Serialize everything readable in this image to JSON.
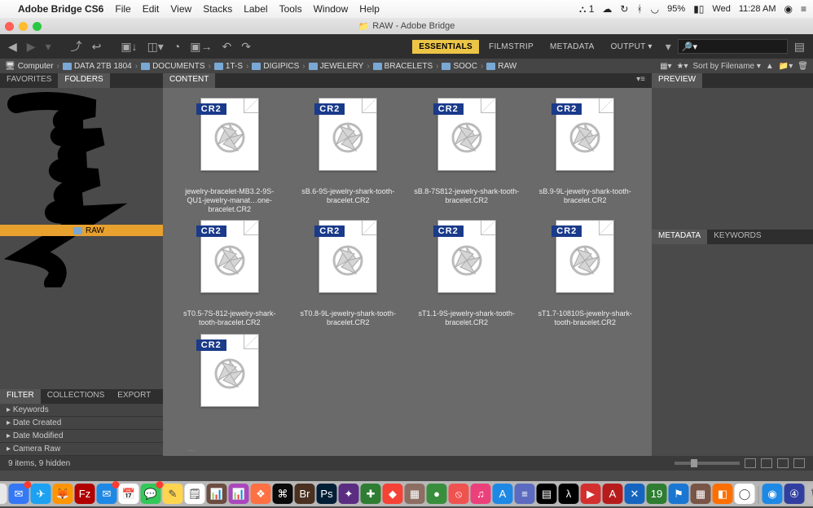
{
  "mac_menu": {
    "app_name": "Adobe Bridge CS6",
    "items": [
      "File",
      "Edit",
      "View",
      "Stacks",
      "Label",
      "Tools",
      "Window",
      "Help"
    ],
    "status_right": {
      "a_badge": "1",
      "battery": "95%",
      "day": "Wed",
      "time": "11:28 AM"
    }
  },
  "window": {
    "title": "RAW - Adobe Bridge"
  },
  "toolbar": {
    "tabs": [
      "ESSENTIALS",
      "FILMSTRIP",
      "METADATA",
      "OUTPUT"
    ],
    "active_tab": "ESSENTIALS",
    "search_placeholder": ""
  },
  "breadcrumb": {
    "items": [
      "Computer",
      "DATA 2TB 1804",
      "DOCUMENTS",
      "1T-S",
      "DIGIPICS",
      "JEWELERY",
      "BRACELETS",
      "SOOC",
      "RAW"
    ],
    "sort_label": "Sort by Filename ▾"
  },
  "left": {
    "tabs": [
      "FAVORITES",
      "FOLDERS"
    ],
    "active_tab": "FOLDERS",
    "selected_folder": "RAW",
    "filter_tabs": [
      "FILTER",
      "COLLECTIONS",
      "EXPORT"
    ],
    "filters": [
      "Keywords",
      "Date Created",
      "Date Modified",
      "Camera Raw"
    ]
  },
  "content": {
    "tab": "CONTENT",
    "files": [
      {
        "name": "jewelry-bracelet-MB3.2-9S-QU1-jewelry-manat…one-bracelet.CR2"
      },
      {
        "name": "sB.6-9S-jewelry-shark-tooth-bracelet.CR2"
      },
      {
        "name": "sB.8-7S812-jewelry-shark-tooth-bracelet.CR2"
      },
      {
        "name": "sB.9-9L-jewelry-shark-tooth-bracelet.CR2"
      },
      {
        "name": "sT0.5-7S-812-jewelry-shark-tooth-bracelet.CR2"
      },
      {
        "name": "sT0.8-9L-jewelry-shark-tooth-bracelet.CR2"
      },
      {
        "name": "sT1.1-9S-jewelry-shark-tooth-bracelet.CR2"
      },
      {
        "name": "sT1.7-10810S-jewelry-shark-tooth-bracelet.CR2"
      },
      {
        "name": ""
      }
    ],
    "truncated_hint": "…",
    "cr2_badge": "CR2"
  },
  "right": {
    "preview_tab": "PREVIEW",
    "meta_tabs": [
      "METADATA",
      "KEYWORDS"
    ]
  },
  "status": {
    "text": "9 items, 9 hidden"
  },
  "dock": {
    "icons": [
      {
        "bg": "#e8e8e8",
        "glyph": "☺"
      },
      {
        "bg": "#3478f6",
        "glyph": "✉",
        "badge": true
      },
      {
        "bg": "#1da1f2",
        "glyph": "✈"
      },
      {
        "bg": "#ff9500",
        "glyph": "🦊"
      },
      {
        "bg": "#b00000",
        "glyph": "Fz"
      },
      {
        "bg": "#1e88e5",
        "glyph": "✉",
        "badge": true
      },
      {
        "bg": "#fff",
        "glyph": "📅"
      },
      {
        "bg": "#34c759",
        "glyph": "💬",
        "badge": true
      },
      {
        "bg": "#ffd54f",
        "glyph": "✎"
      },
      {
        "bg": "#fff",
        "glyph": "🗒"
      },
      {
        "bg": "#6d4c41",
        "glyph": "📊"
      },
      {
        "bg": "#ab47bc",
        "glyph": "📊"
      },
      {
        "bg": "#ff7043",
        "glyph": "❖"
      },
      {
        "bg": "#0a0a0a",
        "glyph": "⌘"
      },
      {
        "bg": "#4a3020",
        "glyph": "Br"
      },
      {
        "bg": "#001e36",
        "glyph": "Ps"
      },
      {
        "bg": "#5a2d82",
        "glyph": "✦"
      },
      {
        "bg": "#2e7d32",
        "glyph": "✚"
      },
      {
        "bg": "#f44336",
        "glyph": "◆"
      },
      {
        "bg": "#8d6e63",
        "glyph": "▦"
      },
      {
        "bg": "#388e3c",
        "glyph": "●"
      },
      {
        "bg": "#ef5350",
        "glyph": "⦸"
      },
      {
        "bg": "#ec407a",
        "glyph": "♫"
      },
      {
        "bg": "#1e88e5",
        "glyph": "A"
      },
      {
        "bg": "#5c6bc0",
        "glyph": "≡"
      },
      {
        "bg": "#000",
        "glyph": "▤"
      },
      {
        "bg": "#000",
        "glyph": "λ"
      },
      {
        "bg": "#d32f2f",
        "glyph": "▶"
      },
      {
        "bg": "#b71c1c",
        "glyph": "A"
      },
      {
        "bg": "#1565c0",
        "glyph": "✕"
      },
      {
        "bg": "#2e7d32",
        "glyph": "19"
      },
      {
        "bg": "#1976d2",
        "glyph": "⚑"
      },
      {
        "bg": "#795548",
        "glyph": "▦"
      },
      {
        "bg": "#ff6f00",
        "glyph": "◧"
      },
      {
        "bg": "#fff",
        "glyph": "◯"
      },
      {
        "bg": "#1e88e5",
        "glyph": "◉"
      },
      {
        "bg": "#303f9f",
        "glyph": "④"
      },
      {
        "bg": "#bdbdbd",
        "glyph": "🗑"
      }
    ]
  }
}
